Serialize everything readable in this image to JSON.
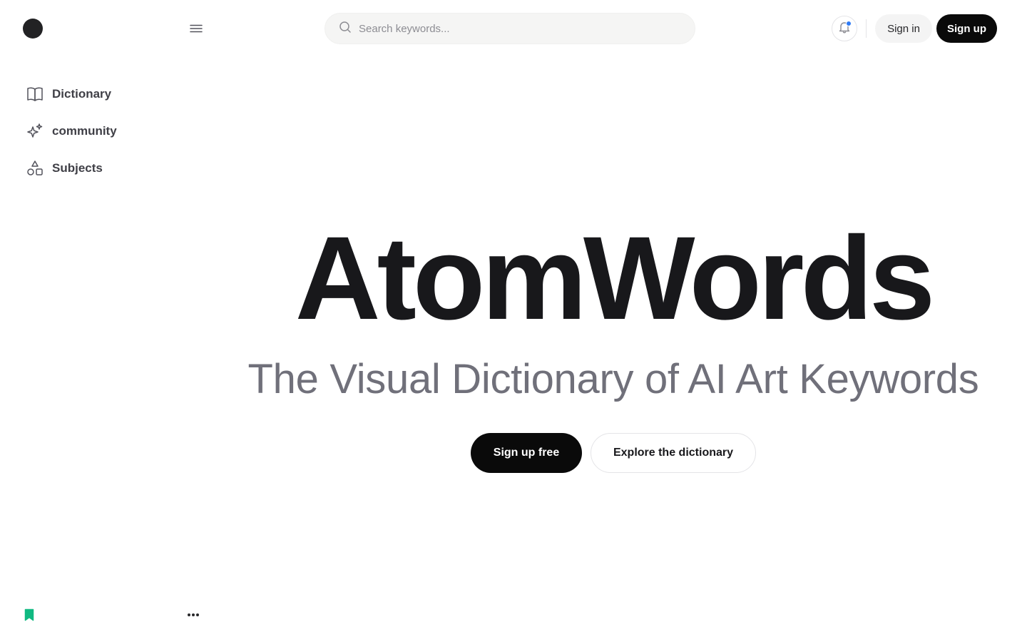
{
  "header": {
    "search_placeholder": "Search keywords...",
    "search_value": "",
    "sign_in_label": "Sign in",
    "sign_up_label": "Sign up",
    "notification_indicator_color": "#2f7bf5"
  },
  "sidebar": {
    "items": [
      {
        "label": "Dictionary",
        "icon": "book-open-icon"
      },
      {
        "label": "community",
        "icon": "sparkles-icon"
      },
      {
        "label": "Subjects",
        "icon": "shapes-icon"
      }
    ],
    "footer": {
      "bookmark_icon": "bookmark-icon",
      "bookmark_color": "#10b981",
      "more_icon": "more-horizontal-icon"
    }
  },
  "hero": {
    "title": "AtomWords",
    "subtitle": "The Visual Dictionary of AI Art Keywords",
    "primary_cta": "Sign up free",
    "secondary_cta": "Explore the dictionary"
  },
  "colors": {
    "primary_button": "#0a0a0a",
    "subtitle_text": "#70707a"
  }
}
